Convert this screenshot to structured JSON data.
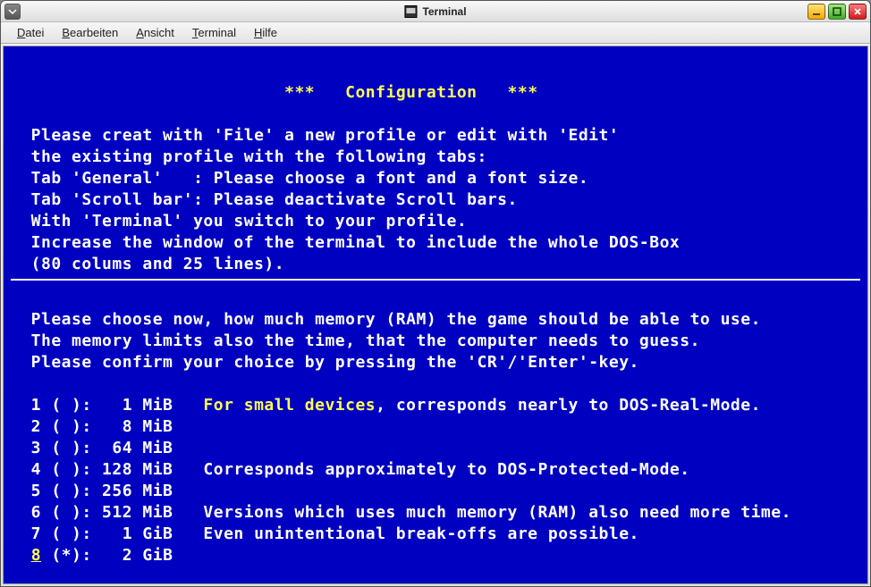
{
  "window": {
    "title": "Terminal"
  },
  "menubar": {
    "items": [
      {
        "label": "Datei",
        "accel": "D"
      },
      {
        "label": "Bearbeiten",
        "accel": "B"
      },
      {
        "label": "Ansicht",
        "accel": "A"
      },
      {
        "label": "Terminal",
        "accel": "T"
      },
      {
        "label": "Hilfe",
        "accel": "H"
      }
    ]
  },
  "content": {
    "heading_stars_l": "***",
    "heading_stars_r": "***",
    "heading": "Configuration",
    "intro": [
      "Please creat with 'File' a new profile or edit with 'Edit'",
      "the existing profile with the following tabs:",
      "Tab 'General'   : Please choose a font and a font size.",
      "Tab 'Scroll bar': Please deactivate Scroll bars.",
      "With 'Terminal' you switch to your profile.",
      "Increase the window of the terminal to include the whole DOS-Box",
      "(80 colums and 25 lines)."
    ],
    "prompt": [
      "Please choose now, how much memory (RAM) the game should be able to use.",
      "The memory limits also the time, that the computer needs to guess.",
      "Please confirm your choice by pressing the 'CR'/'Enter'-key."
    ],
    "options": [
      {
        "n": "1",
        "mark": " ",
        "size": "  1 MiB",
        "hl": "For small devices",
        "rest": ", corresponds nearly to DOS-Real-Mode."
      },
      {
        "n": "2",
        "mark": " ",
        "size": "  8 MiB",
        "hl": "",
        "rest": ""
      },
      {
        "n": "3",
        "mark": " ",
        "size": " 64 MiB",
        "hl": "",
        "rest": ""
      },
      {
        "n": "4",
        "mark": " ",
        "size": "128 MiB",
        "hl": "",
        "rest": "Corresponds approximately to DOS-Protected-Mode."
      },
      {
        "n": "5",
        "mark": " ",
        "size": "256 MiB",
        "hl": "",
        "rest": ""
      },
      {
        "n": "6",
        "mark": " ",
        "size": "512 MiB",
        "hl": "",
        "rest": "Versions which uses much memory (RAM) also need more time."
      },
      {
        "n": "7",
        "mark": " ",
        "size": "  1 GiB",
        "hl": "",
        "rest": "Even unintentional break-offs are possible."
      },
      {
        "n": "8",
        "mark": "*",
        "size": "  2 GiB",
        "hl": "",
        "rest": ""
      }
    ],
    "selected": "8"
  }
}
